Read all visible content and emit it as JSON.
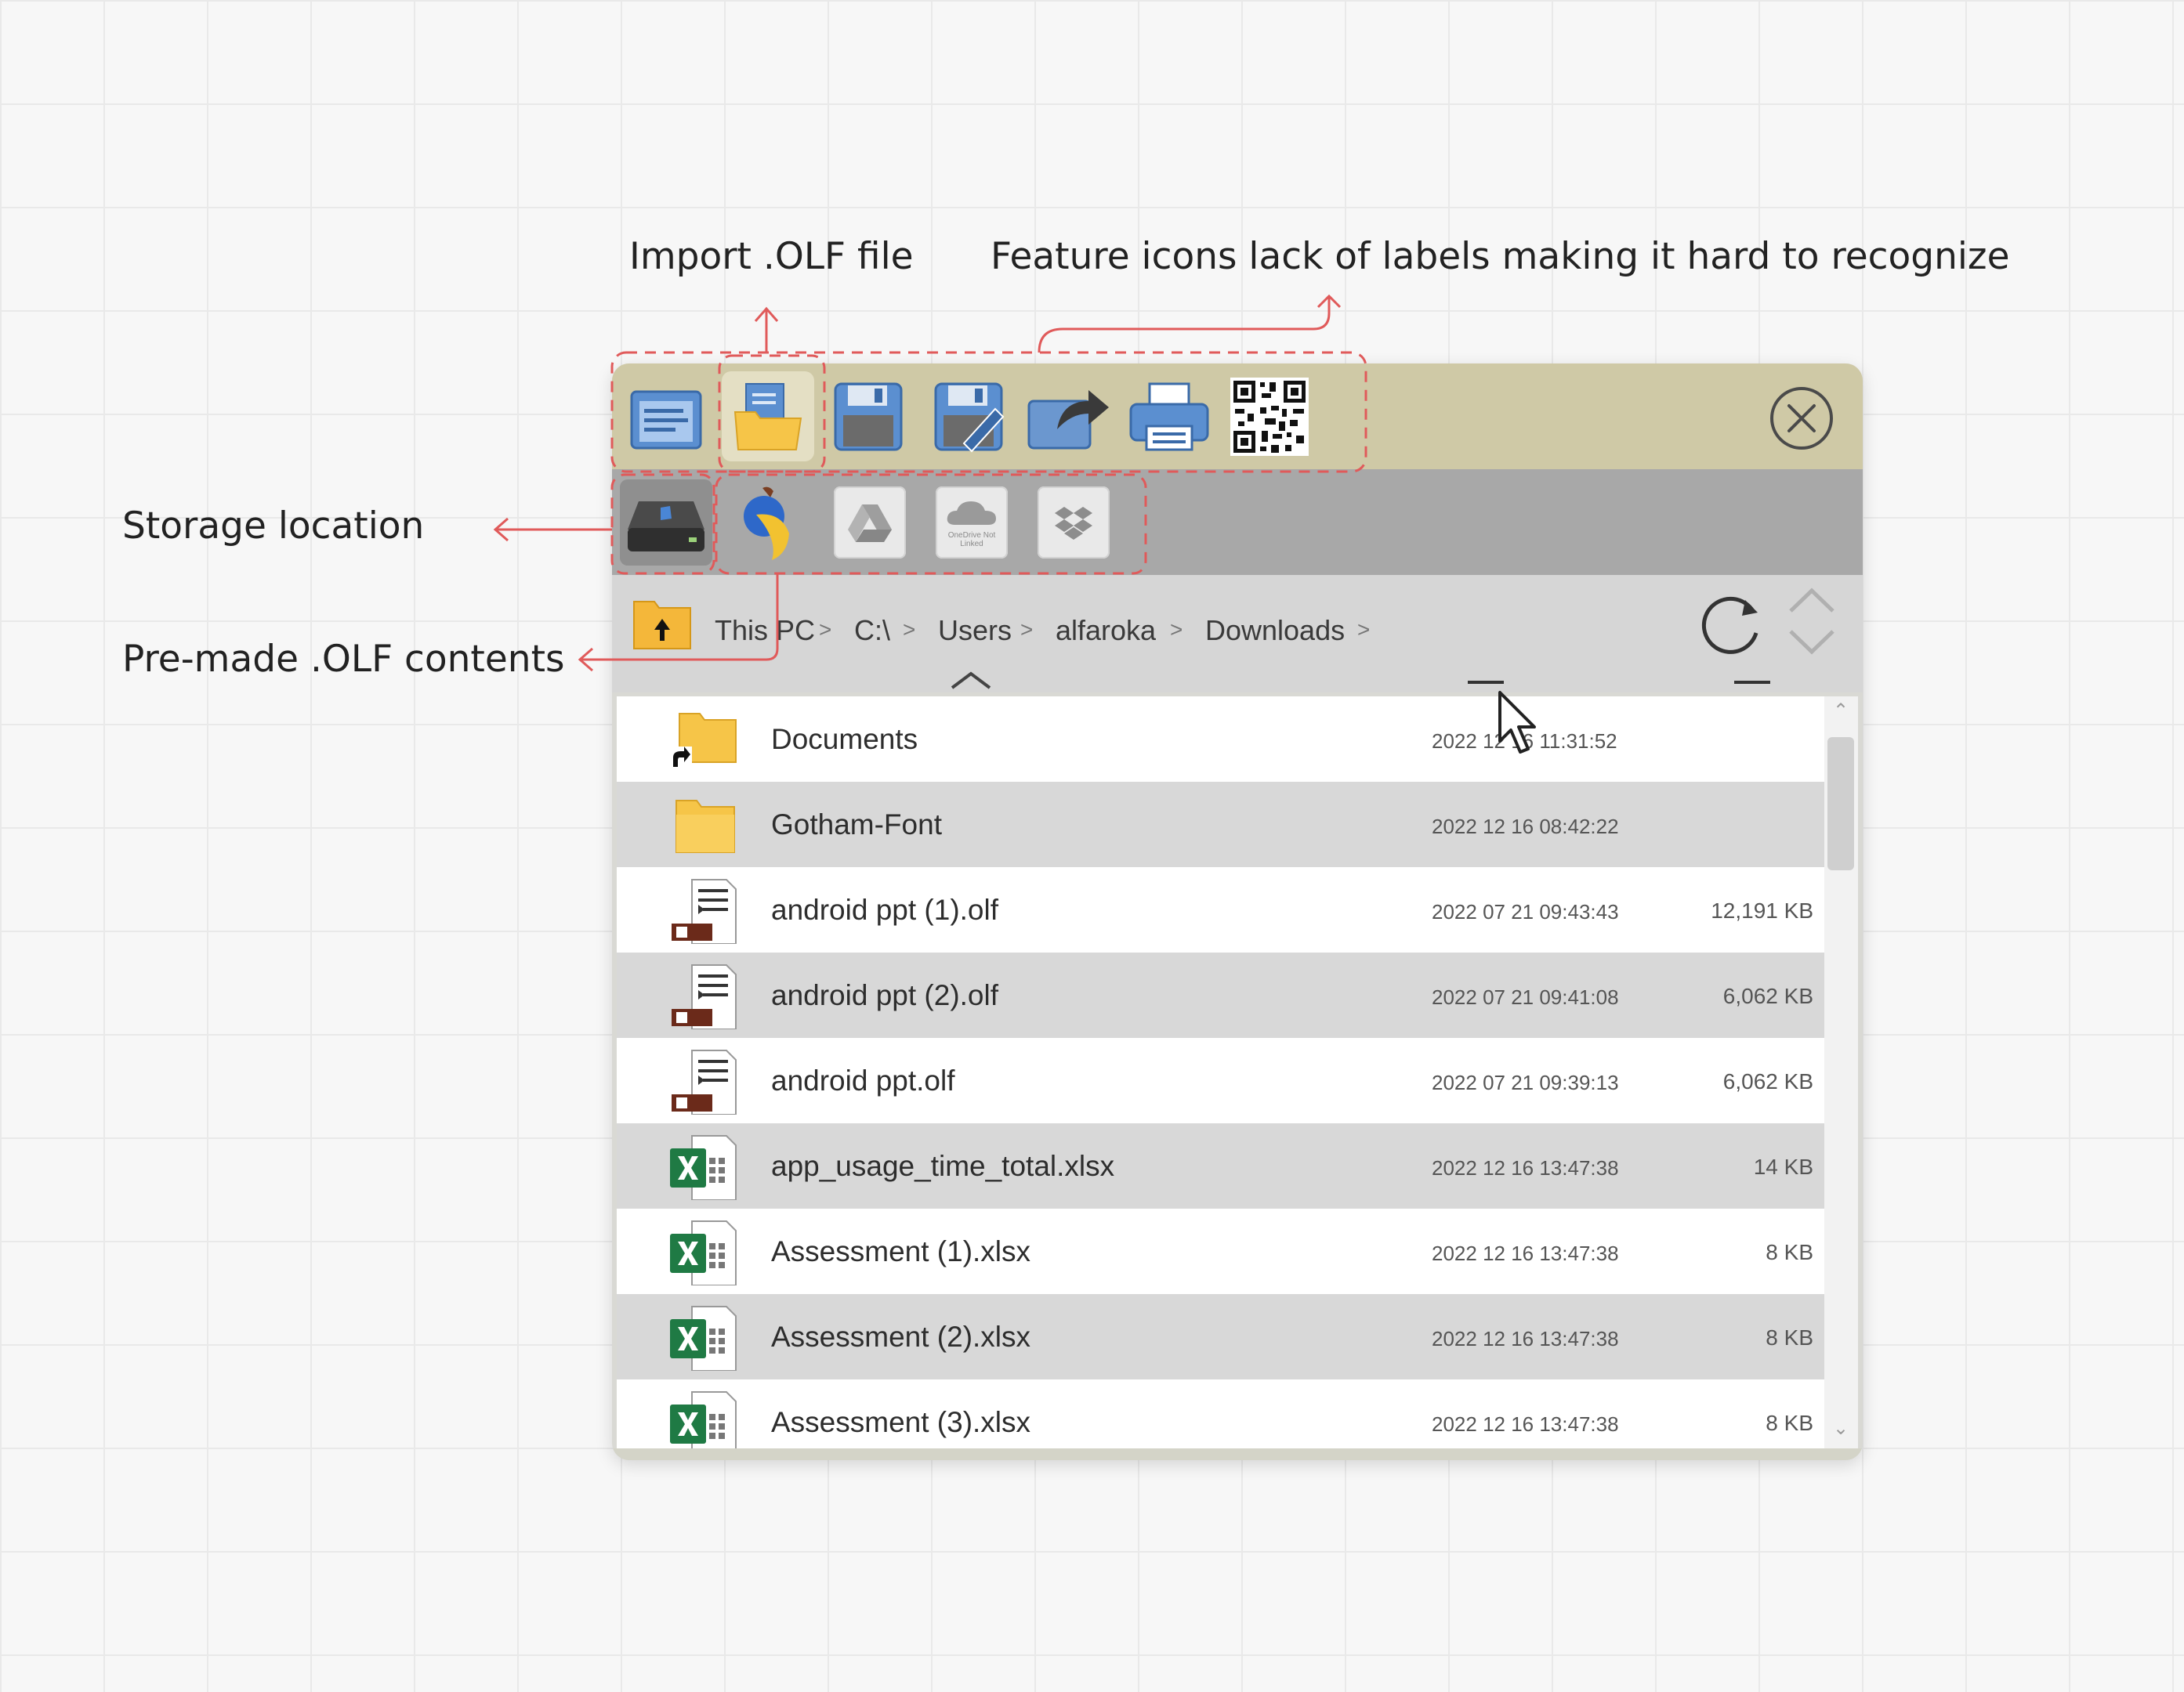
{
  "annotations": {
    "import_olf": "Import .OLF file",
    "feature_icons": "Feature icons lack of labels making it hard to recognize",
    "storage_location": "Storage location",
    "premade_olf": "Pre-made .OLF contents"
  },
  "annotation_color": "#e05a5a",
  "toolbar": {
    "background": "#cfc9a6",
    "buttons": [
      {
        "icon": "new-document-icon"
      },
      {
        "icon": "open-folder-icon"
      },
      {
        "icon": "save-icon"
      },
      {
        "icon": "save-as-icon"
      },
      {
        "icon": "share-icon"
      },
      {
        "icon": "print-icon"
      },
      {
        "icon": "qr-code-icon"
      }
    ],
    "close_icon": "close-icon"
  },
  "storage": {
    "items": [
      {
        "icon": "local-drive-icon"
      },
      {
        "icon": "premade-content-icon"
      },
      {
        "icon": "google-drive-icon"
      },
      {
        "icon": "onedrive-icon",
        "caption": "OneDrive Not Linked"
      },
      {
        "icon": "dropbox-icon"
      }
    ]
  },
  "breadcrumb": {
    "segments": [
      "This PC",
      "C:\\",
      "Users",
      "alfaroka",
      "Downloads"
    ],
    "separator": ">"
  },
  "files": [
    {
      "type": "folder-shortcut",
      "name": "Documents",
      "date": "2022 12 16 11:31:52",
      "size": ""
    },
    {
      "type": "folder",
      "name": "Gotham-Font",
      "date": "2022 12 16 08:42:22",
      "size": ""
    },
    {
      "type": "olf",
      "name": "android ppt (1).olf",
      "date": "2022 07 21 09:43:43",
      "size": "12,191 KB"
    },
    {
      "type": "olf",
      "name": "android ppt (2).olf",
      "date": "2022 07 21 09:41:08",
      "size": "6,062 KB"
    },
    {
      "type": "olf",
      "name": "android ppt.olf",
      "date": "2022 07 21 09:39:13",
      "size": "6,062 KB"
    },
    {
      "type": "xlsx",
      "name": "app_usage_time_total.xlsx",
      "date": "2022 12 16 13:47:38",
      "size": "14 KB"
    },
    {
      "type": "xlsx",
      "name": "Assessment (1).xlsx",
      "date": "2022 12 16 13:47:38",
      "size": "8 KB"
    },
    {
      "type": "xlsx",
      "name": "Assessment (2).xlsx",
      "date": "2022 12 16 13:47:38",
      "size": "8 KB"
    },
    {
      "type": "xlsx",
      "name": "Assessment (3).xlsx",
      "date": "2022 12 16 13:47:38",
      "size": "8 KB"
    }
  ]
}
